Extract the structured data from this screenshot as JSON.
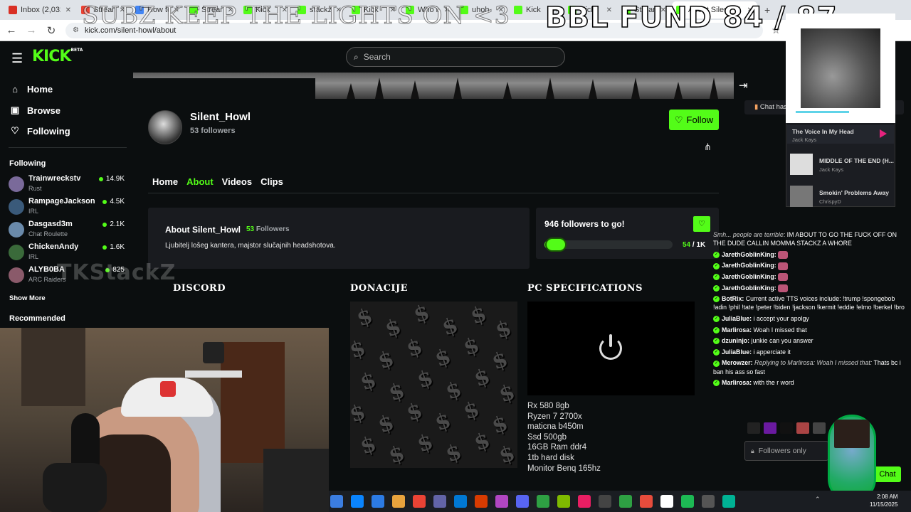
{
  "browser": {
    "tabs": [
      {
        "label": "Inbox (2,032) -",
        "color": "#d93025"
      },
      {
        "label": "Stream Button",
        "color": "#ea4335"
      },
      {
        "label": "How to set",
        "color": "#4285f4"
      },
      {
        "label": "Stream - Kick",
        "color": "#53fc18"
      },
      {
        "label": "Kick",
        "color": "#53fc18"
      },
      {
        "label": "stackz Strea",
        "color": "#53fc18"
      },
      {
        "label": "Kick",
        "color": "#53fc18"
      },
      {
        "label": "Who is",
        "color": "#53fc18"
      },
      {
        "label": "uhoh",
        "color": "#53fc18"
      },
      {
        "label": "Kick",
        "color": "#53fc18"
      },
      {
        "label": "Kick",
        "color": "#53fc18"
      },
      {
        "label": "Stream",
        "color": "#53fc18"
      },
      {
        "label": "About Silent_H",
        "color": "#53fc18",
        "active": true
      }
    ],
    "url": "kick.com/silent-howl/about"
  },
  "overlay": {
    "banner_left": "SUBZ KEEP THE LIGHTS ON <3",
    "banner_right": "BBL FUND  84 / 87",
    "watermark": "TKStackZ"
  },
  "header": {
    "logo": "KICK",
    "logo_sup": "BETA",
    "search_placeholder": "Search"
  },
  "sidebar": {
    "nav": [
      {
        "label": "Home",
        "icon": "home-icon"
      },
      {
        "label": "Browse",
        "icon": "browse-icon"
      },
      {
        "label": "Following",
        "icon": "heart-icon"
      }
    ],
    "following_heading": "Following",
    "following": [
      {
        "name": "Trainwreckstv",
        "category": "Rust",
        "viewers": "14.9K",
        "color": "#7a6a9a"
      },
      {
        "name": "RampageJackson",
        "category": "IRL",
        "viewers": "4.5K",
        "color": "#3a5a7a"
      },
      {
        "name": "Dasgasd3m",
        "category": "Chat Roulette",
        "viewers": "2.1K",
        "color": "#6a8aaa"
      },
      {
        "name": "ChickenAndy",
        "category": "IRL",
        "viewers": "1.6K",
        "color": "#3a6a3a"
      },
      {
        "name": "ALYB0BA",
        "category": "ARC Raiders",
        "viewers": "825",
        "color": "#8a5a6a"
      }
    ],
    "show_more": "Show More",
    "recommended_heading": "Recommended"
  },
  "channel": {
    "name": "Silent_Howl",
    "followers": "53 followers",
    "follow_label": "Follow",
    "tabs": [
      {
        "label": "Home",
        "active": false
      },
      {
        "label": "About",
        "active": true
      },
      {
        "label": "Videos",
        "active": false
      },
      {
        "label": "Clips",
        "active": false
      }
    ],
    "about_title": "About Silent_Howl",
    "about_count": "53",
    "about_count_label": "Followers",
    "about_desc": "Ljubitelj lošeg kantera, majstor slučajnih headshotova.",
    "goal_title": "946 followers to go!",
    "goal_current": "54",
    "goal_target": "/ 1K",
    "goal_fraction": 0.054,
    "panels": {
      "discord": "DISCORD",
      "donacije": "DONACIJE",
      "pc": "PC SPECIFICATIONS"
    },
    "pc_specs": [
      "Rx 580 8gb",
      "Ryzen 7 2700x",
      "maticna b450m",
      "Ssd 500gb",
      "16GB Ram ddr4",
      "1tb hard disk",
      "Monitor Benq 165hz"
    ]
  },
  "chat": {
    "pinned": "Chat has b",
    "messages": [
      {
        "user": "",
        "prefix": "Smh... people are terrible",
        "text": "IM ABOUT TO GO THE FUCK OFF ON THE DUDE CALLIN MOMMA STACKZ A WHORE",
        "badge": false,
        "emote": false
      },
      {
        "user": "JarethGoblinKing:",
        "text": "",
        "badge": true,
        "emote": true
      },
      {
        "user": "JarethGoblinKing:",
        "text": "",
        "badge": true,
        "emote": true
      },
      {
        "user": "JarethGoblinKing:",
        "text": "",
        "badge": true,
        "emote": true
      },
      {
        "user": "JarethGoblinKing:",
        "text": "",
        "badge": true,
        "emote": true
      },
      {
        "user": "BotRix:",
        "text": "Current active TTS voices include: !trump !spongebob !adin !phil !tate !peter !biden !jackson !kermit !eddie !elmo !berkel !bro",
        "badge": true,
        "emote": false
      },
      {
        "user": "JuliaBlue:",
        "text": "i accept your apolgy",
        "badge": true,
        "emote": false
      },
      {
        "user": "Marlirosa:",
        "text": "Woah I missed that",
        "badge": true,
        "emote": false
      },
      {
        "user": "dzuninjo:",
        "text": "junkie can you answer",
        "badge": true,
        "emote": false
      },
      {
        "user": "JuliaBlue:",
        "text": "i apperciate it",
        "badge": true,
        "emote": false
      },
      {
        "user": "Merowzer:",
        "reply": "Replying to Marlirosa: Woah I missed that:",
        "text": "Thats bc i ban his ass so fast",
        "badge": true,
        "emote": false
      },
      {
        "user": "Marlirosa:",
        "text": "with the r word",
        "badge": true,
        "emote": false
      }
    ],
    "input_placeholder": "Followers only",
    "chat_button": "Chat"
  },
  "music": {
    "now_playing": {
      "title": "The Voice In My Head",
      "artist": "Jack Kays"
    },
    "queue": [
      {
        "title": "MIDDLE OF THE END (H...",
        "artist": "Jack Kays"
      },
      {
        "title": "Smokin' Problems Away",
        "artist": "ChrispyD"
      }
    ],
    "progress": 0.5
  },
  "system": {
    "time": "2:08 AM",
    "date": "11/15/2025"
  }
}
